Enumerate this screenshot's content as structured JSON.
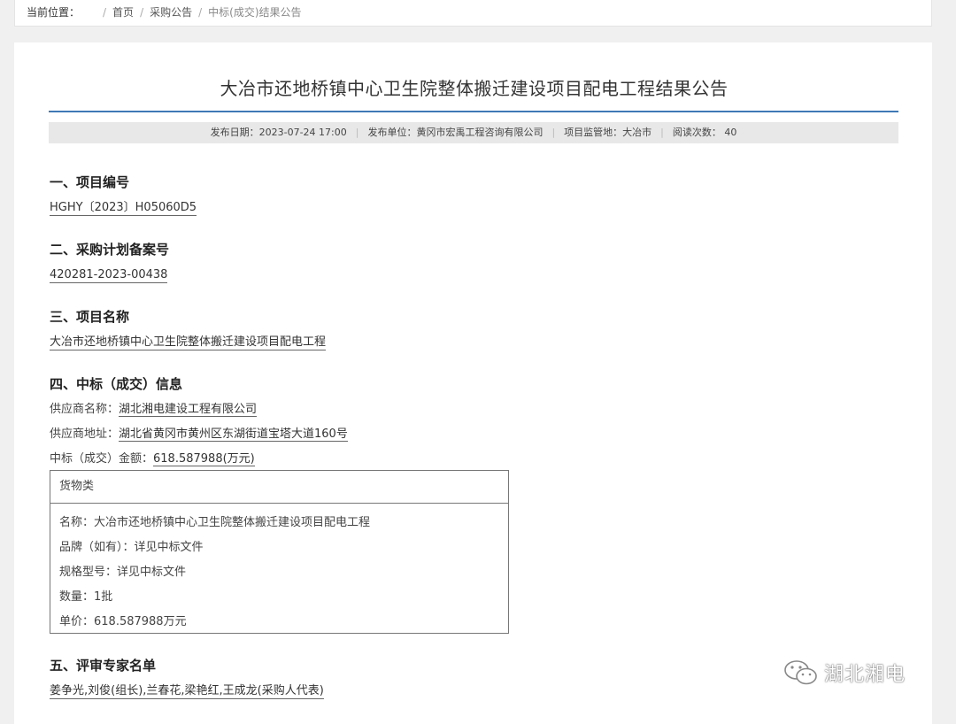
{
  "breadcrumb": {
    "label": "当前位置：",
    "items": [
      "首页",
      "采购公告"
    ],
    "current": "中标(成交)结果公告"
  },
  "article": {
    "title": "大冶市还地桥镇中心卫生院整体搬迁建设项目配电工程结果公告",
    "meta": {
      "publish_date": "发布日期：2023-07-24 17:00",
      "publisher": "发布单位：黄冈市宏禹工程咨询有限公司",
      "region": "项目监管地：大冶市",
      "views": "阅读次数： 40"
    },
    "sections": {
      "s1_heading": "一、项目编号",
      "s1_value": "HGHY〔2023〕H05060D5",
      "s2_heading": "二、采购计划备案号",
      "s2_value": "420281-2023-00438",
      "s3_heading": "三、项目名称",
      "s3_value": "大冶市还地桥镇中心卫生院整体搬迁建设项目配电工程",
      "s4_heading": "四、中标（成交）信息",
      "supplier_name_label": "供应商名称：",
      "supplier_name": "湖北湘电建设工程有限公司",
      "supplier_addr_label": "供应商地址：",
      "supplier_addr": "湖北省黄冈市黄州区东湖街道宝塔大道160号",
      "amount_label": "中标（成交）金额：",
      "amount": "618.587988(万元)",
      "s5_heading": "五、评审专家名单",
      "s5_value": "姜争光,刘俊(组长),兰春花,梁艳红,王成龙(采购人代表)"
    },
    "goods": {
      "category": "货物类",
      "name": "名称：大冶市还地桥镇中心卫生院整体搬迁建设项目配电工程",
      "brand": "品牌（如有）：详见中标文件",
      "model": "规格型号：详见中标文件",
      "quantity": "数量：1批",
      "unit_price": "单价：618.587988万元"
    }
  },
  "watermark": {
    "text": "湖北湘电",
    "icon": "wechat-icon"
  }
}
